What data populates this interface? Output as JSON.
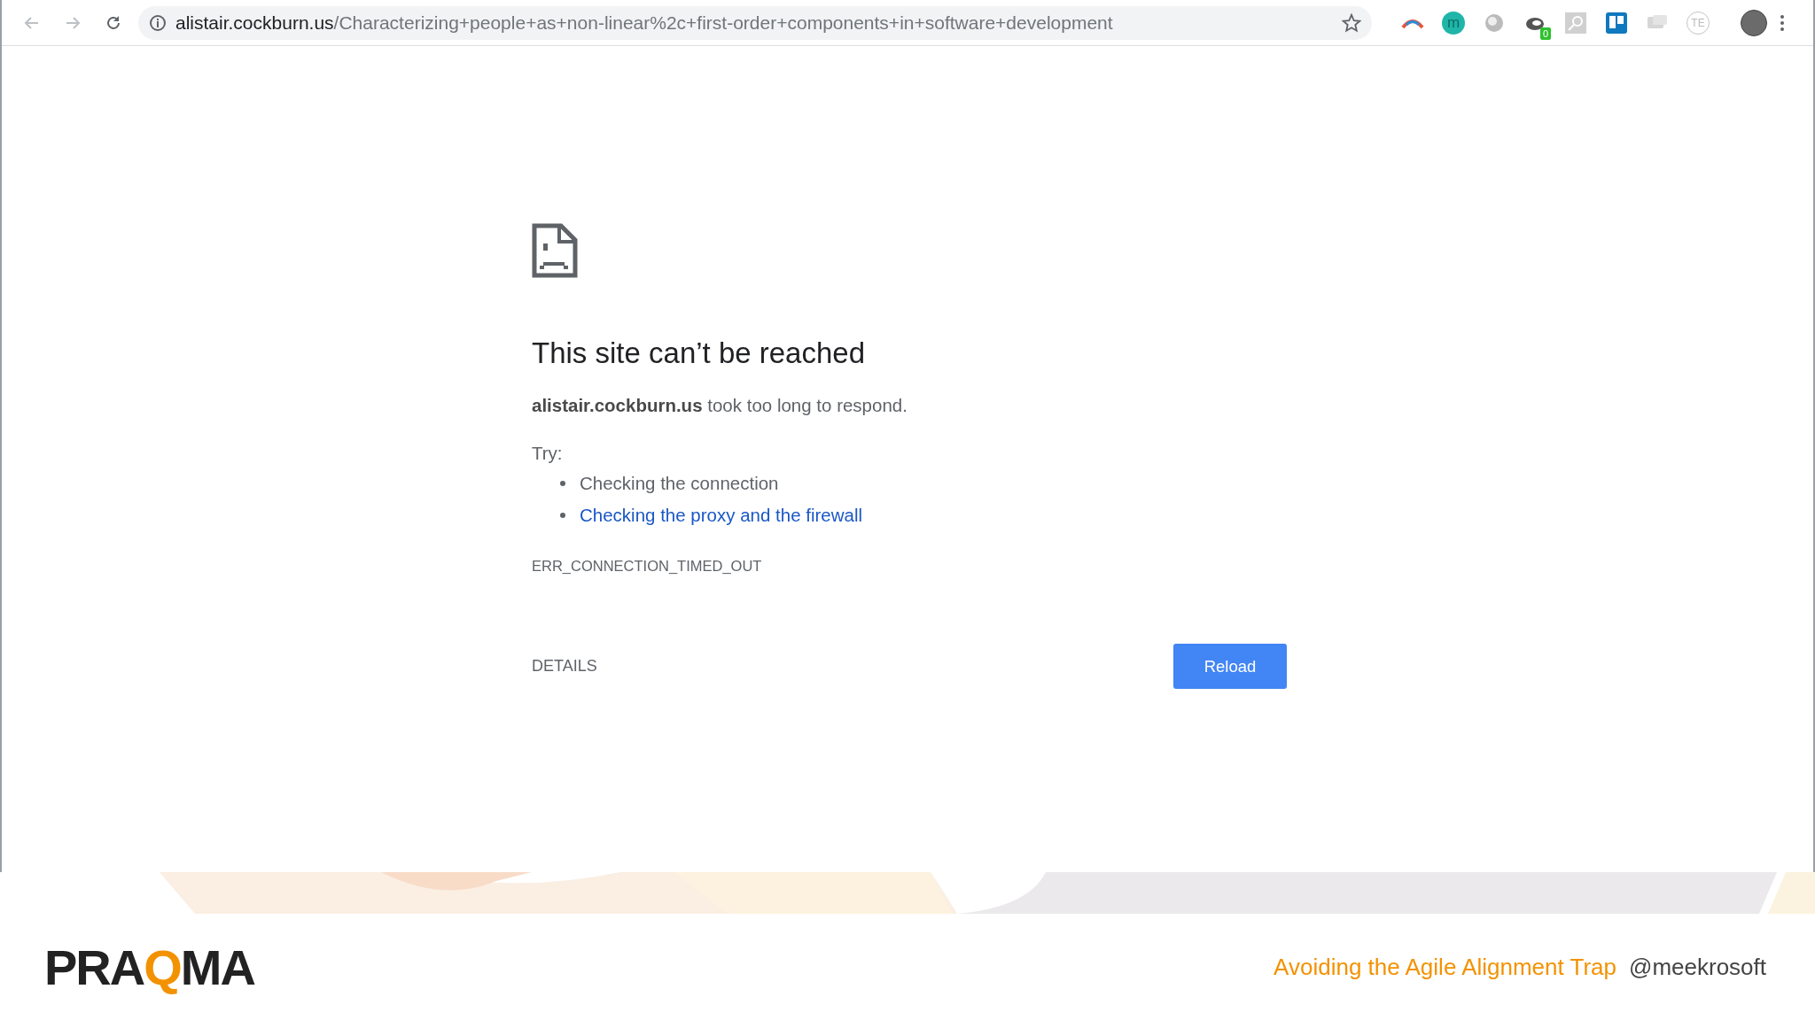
{
  "browser": {
    "url_host": "alistair.cockburn.us",
    "url_path": "/Characterizing+people+as+non-linear%2c+first-order+components+in+software+development",
    "bookmarked": false,
    "extensions": [
      {
        "kind": "arc"
      },
      {
        "kind": "circle",
        "label": "m",
        "color": "#1fb5a8"
      },
      {
        "kind": "sphere"
      },
      {
        "kind": "badge",
        "label": "0"
      },
      {
        "kind": "magnifier"
      },
      {
        "kind": "board"
      },
      {
        "kind": "chat"
      },
      {
        "kind": "circle-outline",
        "label": "TE"
      }
    ]
  },
  "error": {
    "title": "This site can’t be reached",
    "message": "**alistair.cockburn.us** took too long to respond.",
    "try_label": "Try:",
    "suggestions": [
      {
        "text": "Checking the connection",
        "link": false
      },
      {
        "text": "Checking the proxy and the firewall",
        "link": true
      }
    ],
    "code": "ERR_CONNECTION_TIMED_OUT",
    "details": "DETAILS",
    "reload": "Reload"
  },
  "footer": {
    "logo": [
      {
        "text": "PRA",
        "accent": false
      },
      {
        "text": "Q",
        "accent": true
      },
      {
        "text": "MA",
        "accent": false
      }
    ],
    "talk_title": "Avoiding the Agile Alignment Trap",
    "handle": "@meekrosoft"
  }
}
